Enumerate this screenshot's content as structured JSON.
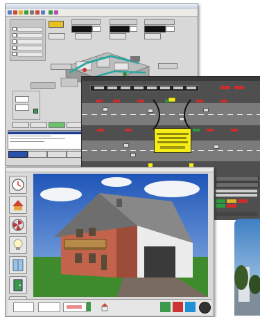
{
  "colors": {
    "window_gray": "#d8d8d8",
    "traffic_dark": "#4f4f4f",
    "alarm_yellow": "#f5ec18",
    "alarm_red": "#cc2e2e",
    "ok_green": "#2b9b3e",
    "sky_blue": "#2b66c6",
    "roof_gray": "#6e6e6e",
    "brick": "#c4634b",
    "lawn": "#3e8b2e"
  },
  "icons": [
    "tunnel-ventilation-schematic",
    "traffic-lane-diagram",
    "clock-icon",
    "roof-icon",
    "fan-icon",
    "lightbulb-icon",
    "window-icon",
    "door-icon",
    "car-icon",
    "house-icon",
    "power-icon"
  ]
}
